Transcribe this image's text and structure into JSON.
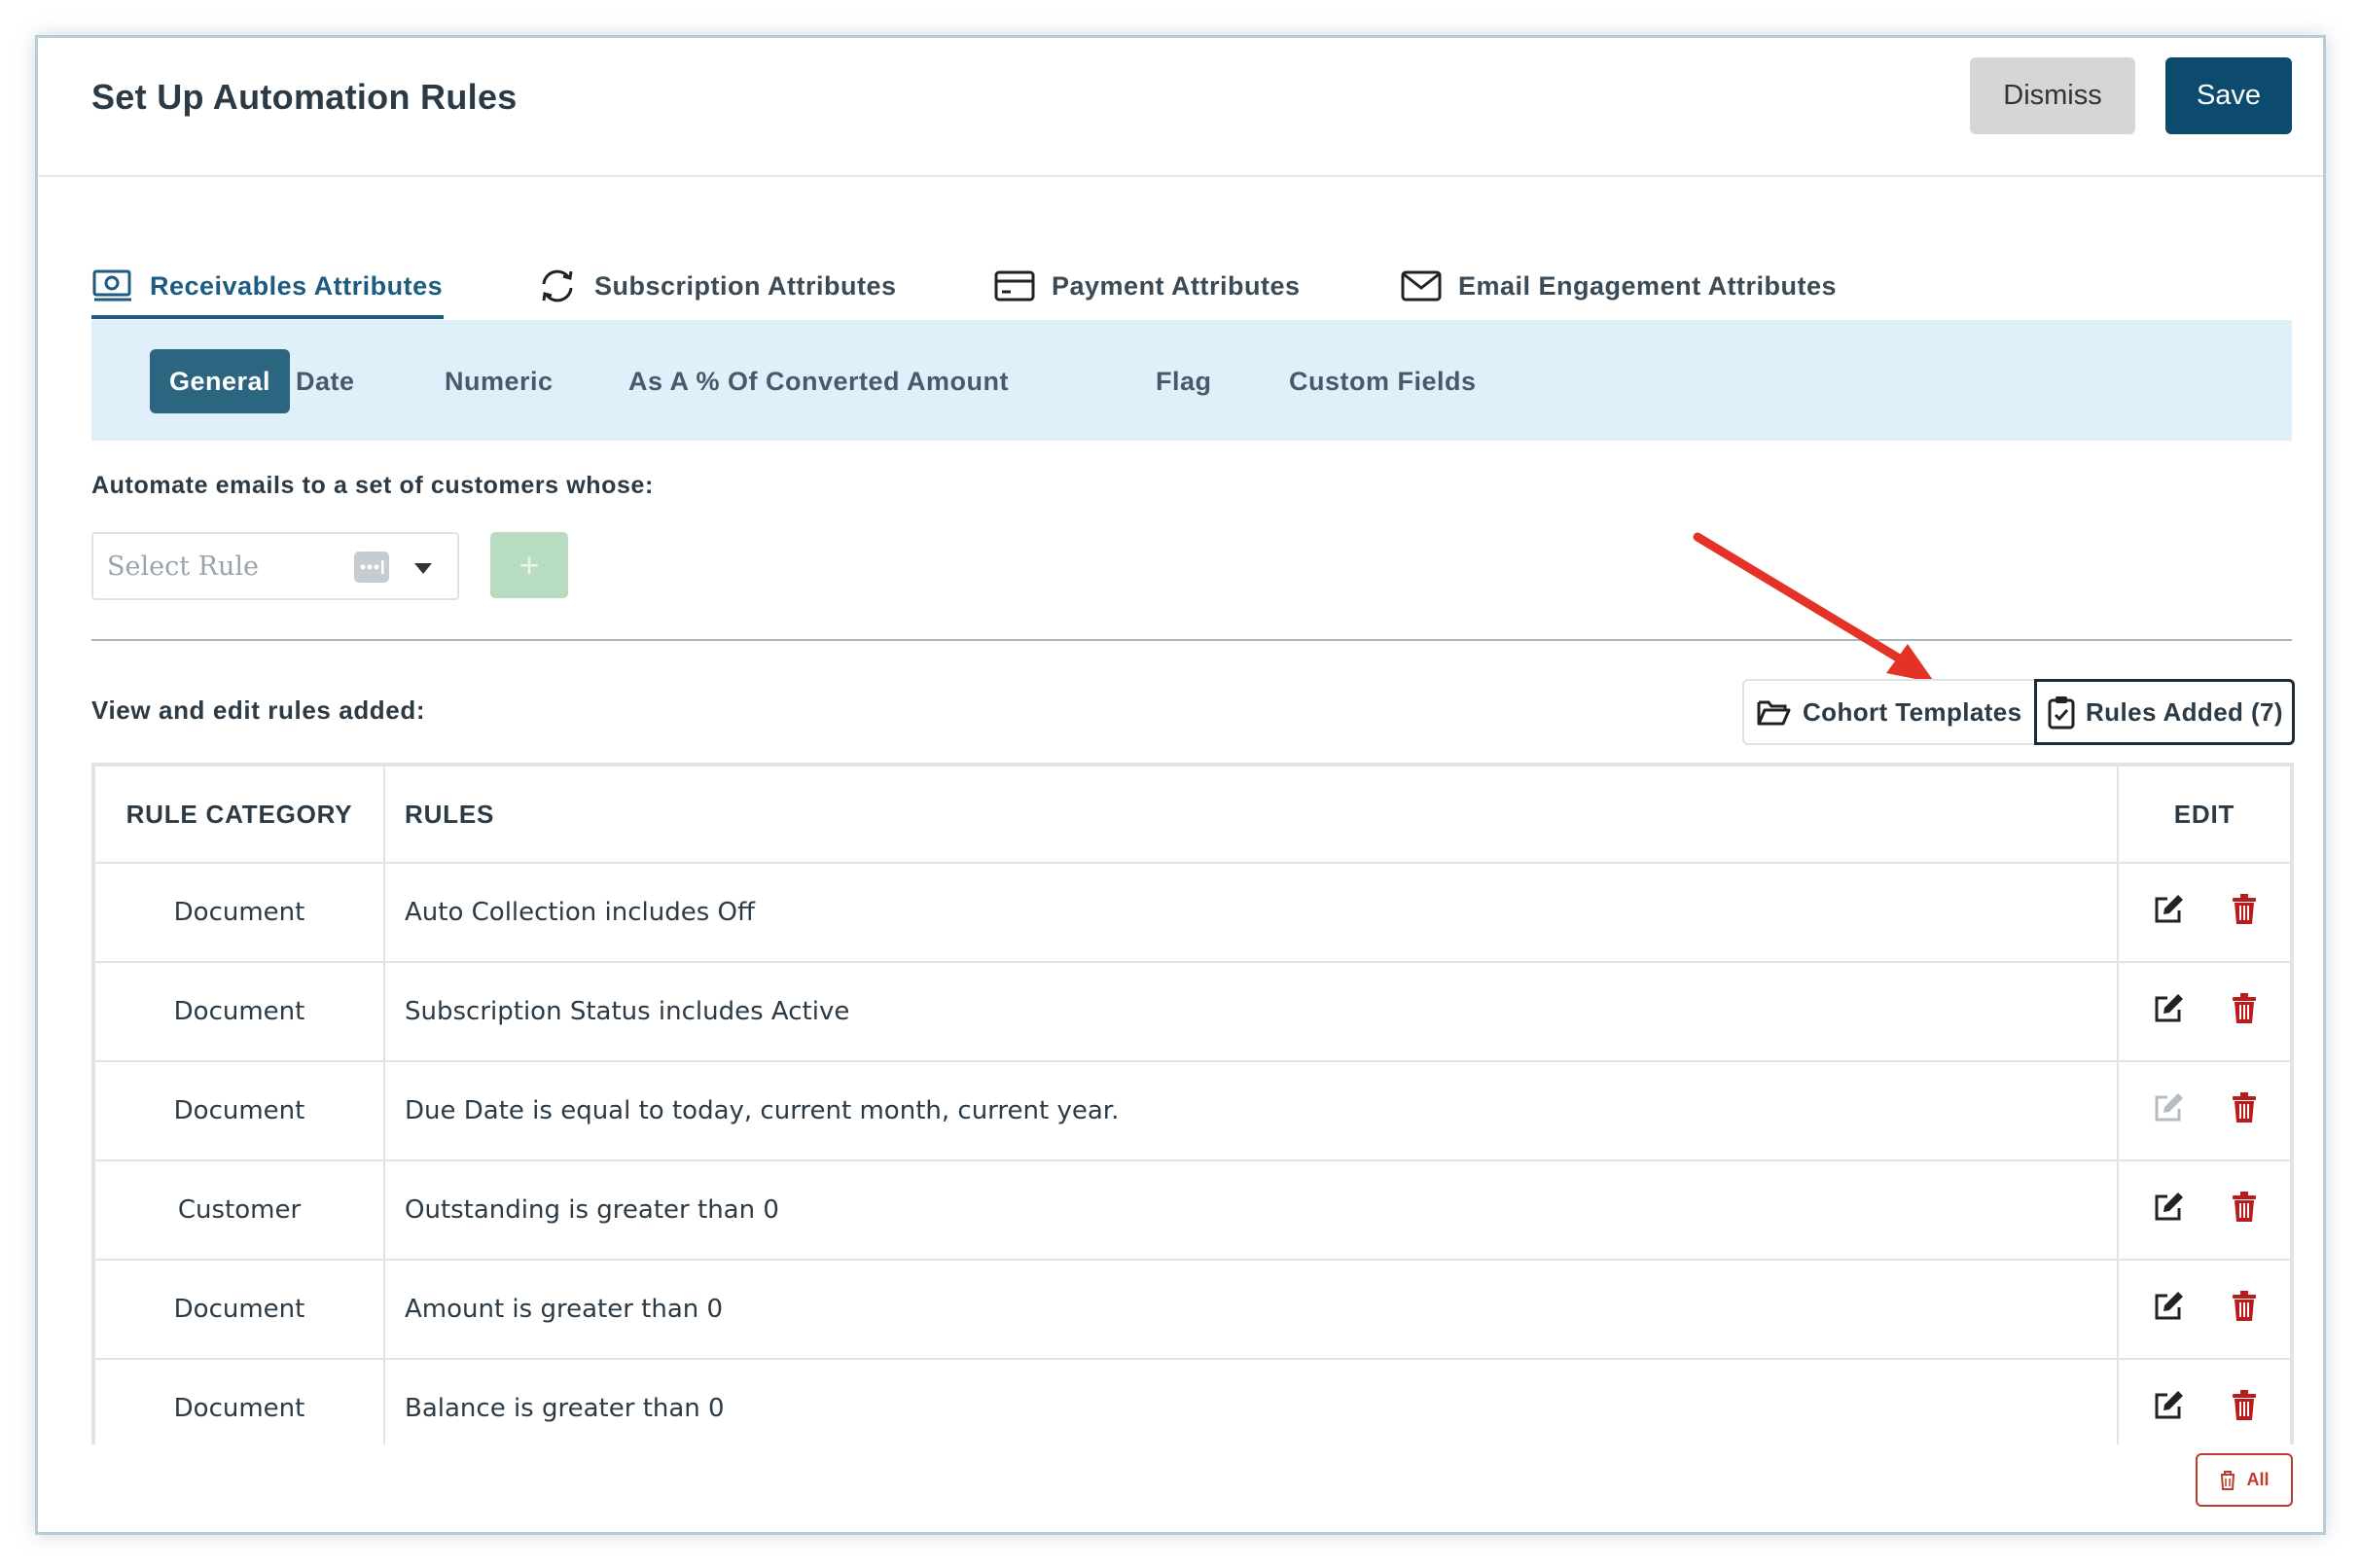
{
  "header": {
    "title": "Set Up Automation Rules",
    "dismiss_label": "Dismiss",
    "save_label": "Save"
  },
  "primary_tabs": [
    {
      "label": "Receivables Attributes",
      "icon": "money-icon",
      "active": true
    },
    {
      "label": "Subscription Attributes",
      "icon": "refresh-icon",
      "active": false
    },
    {
      "label": "Payment Attributes",
      "icon": "credit-card-icon",
      "active": false
    },
    {
      "label": "Email Engagement Attributes",
      "icon": "envelope-icon",
      "active": false
    }
  ],
  "sub_tabs": [
    {
      "label": "General",
      "active": true
    },
    {
      "label": "Date",
      "active": false
    },
    {
      "label": "Numeric",
      "active": false
    },
    {
      "label": "As A % Of Converted Amount",
      "active": false
    },
    {
      "label": "Flag",
      "active": false
    },
    {
      "label": "Custom Fields",
      "active": false
    }
  ],
  "automate": {
    "label": "Automate emails to a set of customers whose:",
    "select_placeholder": "Select Rule",
    "add_label": "+"
  },
  "rules_section": {
    "label": "View and edit rules added:",
    "cohort_templates_label": "Cohort Templates",
    "rules_added_label": "Rules Added (7)"
  },
  "table": {
    "headers": [
      "RULE CATEGORY",
      "RULES",
      "EDIT"
    ],
    "rows": [
      {
        "category": "Document",
        "rule": "Auto Collection includes Off",
        "edit_enabled": true
      },
      {
        "category": "Document",
        "rule": "Subscription Status includes Active",
        "edit_enabled": true
      },
      {
        "category": "Document",
        "rule": "Due Date is equal to today, current month, current year.",
        "edit_enabled": false
      },
      {
        "category": "Customer",
        "rule": "Outstanding is greater than 0",
        "edit_enabled": true
      },
      {
        "category": "Document",
        "rule": "Amount is greater than 0",
        "edit_enabled": true
      },
      {
        "category": "Document",
        "rule": "Balance is greater than 0",
        "edit_enabled": true
      }
    ]
  },
  "delete_all_label": "All",
  "colors": {
    "primary": "#0c4a6e",
    "active_tab": "#1c5c80",
    "subbar_bg": "#dff0fb",
    "delete": "#b91c1c",
    "arrow": "#e53227"
  }
}
